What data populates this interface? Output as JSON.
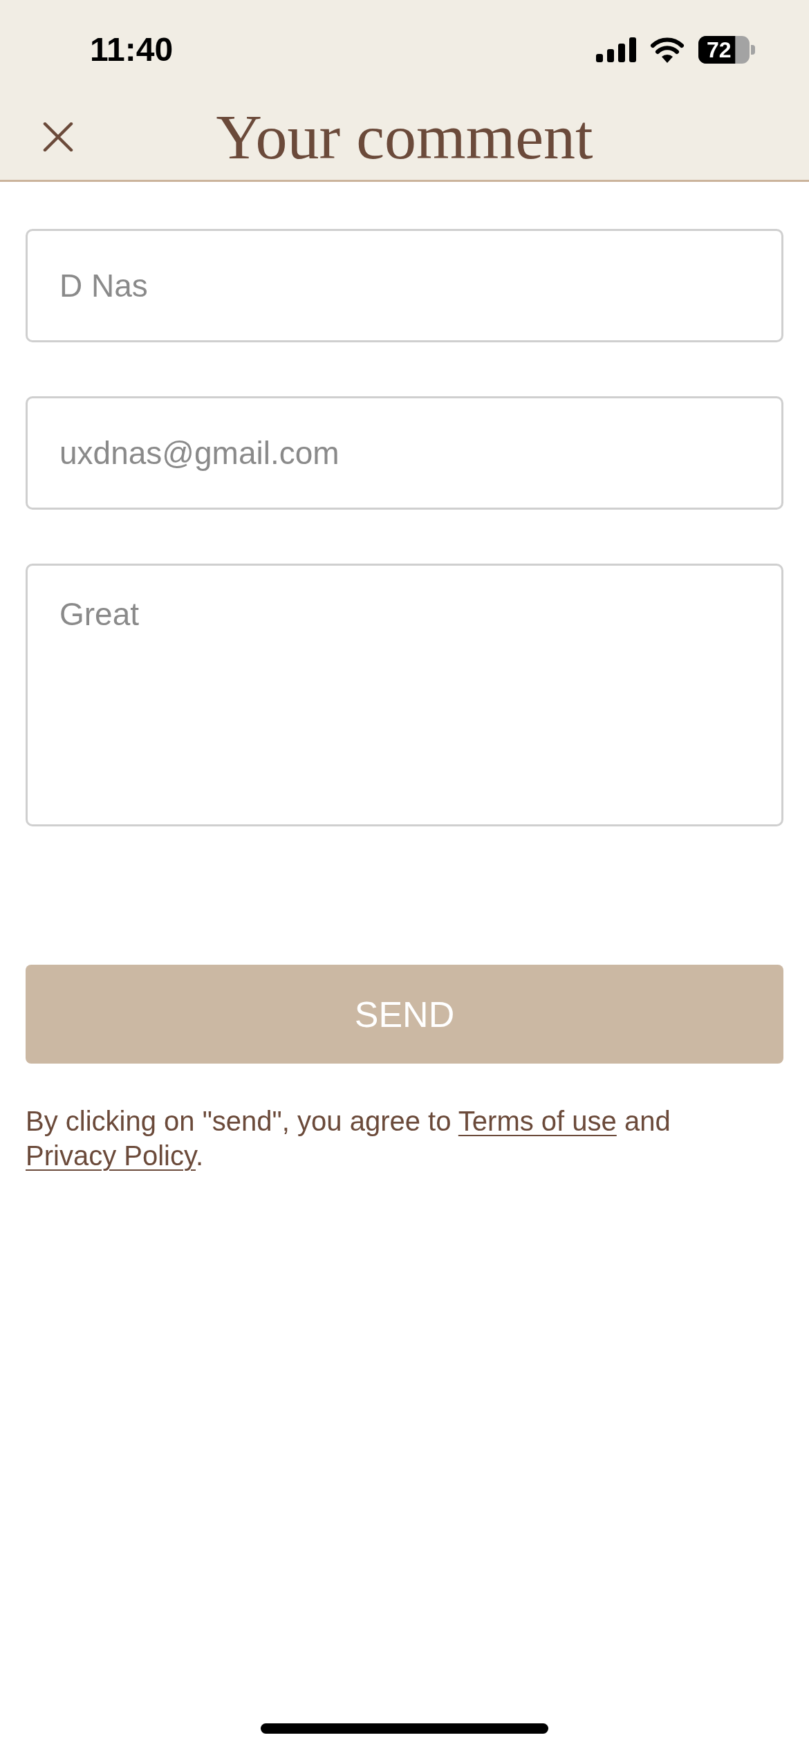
{
  "status_bar": {
    "time": "11:40",
    "battery": "72"
  },
  "header": {
    "title": "Your comment"
  },
  "form": {
    "fields": [
      {
        "kind": "input",
        "value": "D Nas"
      },
      {
        "kind": "input",
        "value": "uxdnas@gmail.com"
      },
      {
        "kind": "textarea",
        "value": "Great"
      }
    ],
    "submit": {
      "label": "SEND"
    }
  },
  "legal": {
    "segments": [
      {
        "kind": "text",
        "text": "By clicking on \"send\", you agree to "
      },
      {
        "kind": "link",
        "text": "Terms of use"
      },
      {
        "kind": "text",
        "text": " and "
      },
      {
        "kind": "link",
        "text": "Privacy Policy"
      },
      {
        "kind": "text",
        "text": "."
      }
    ]
  }
}
